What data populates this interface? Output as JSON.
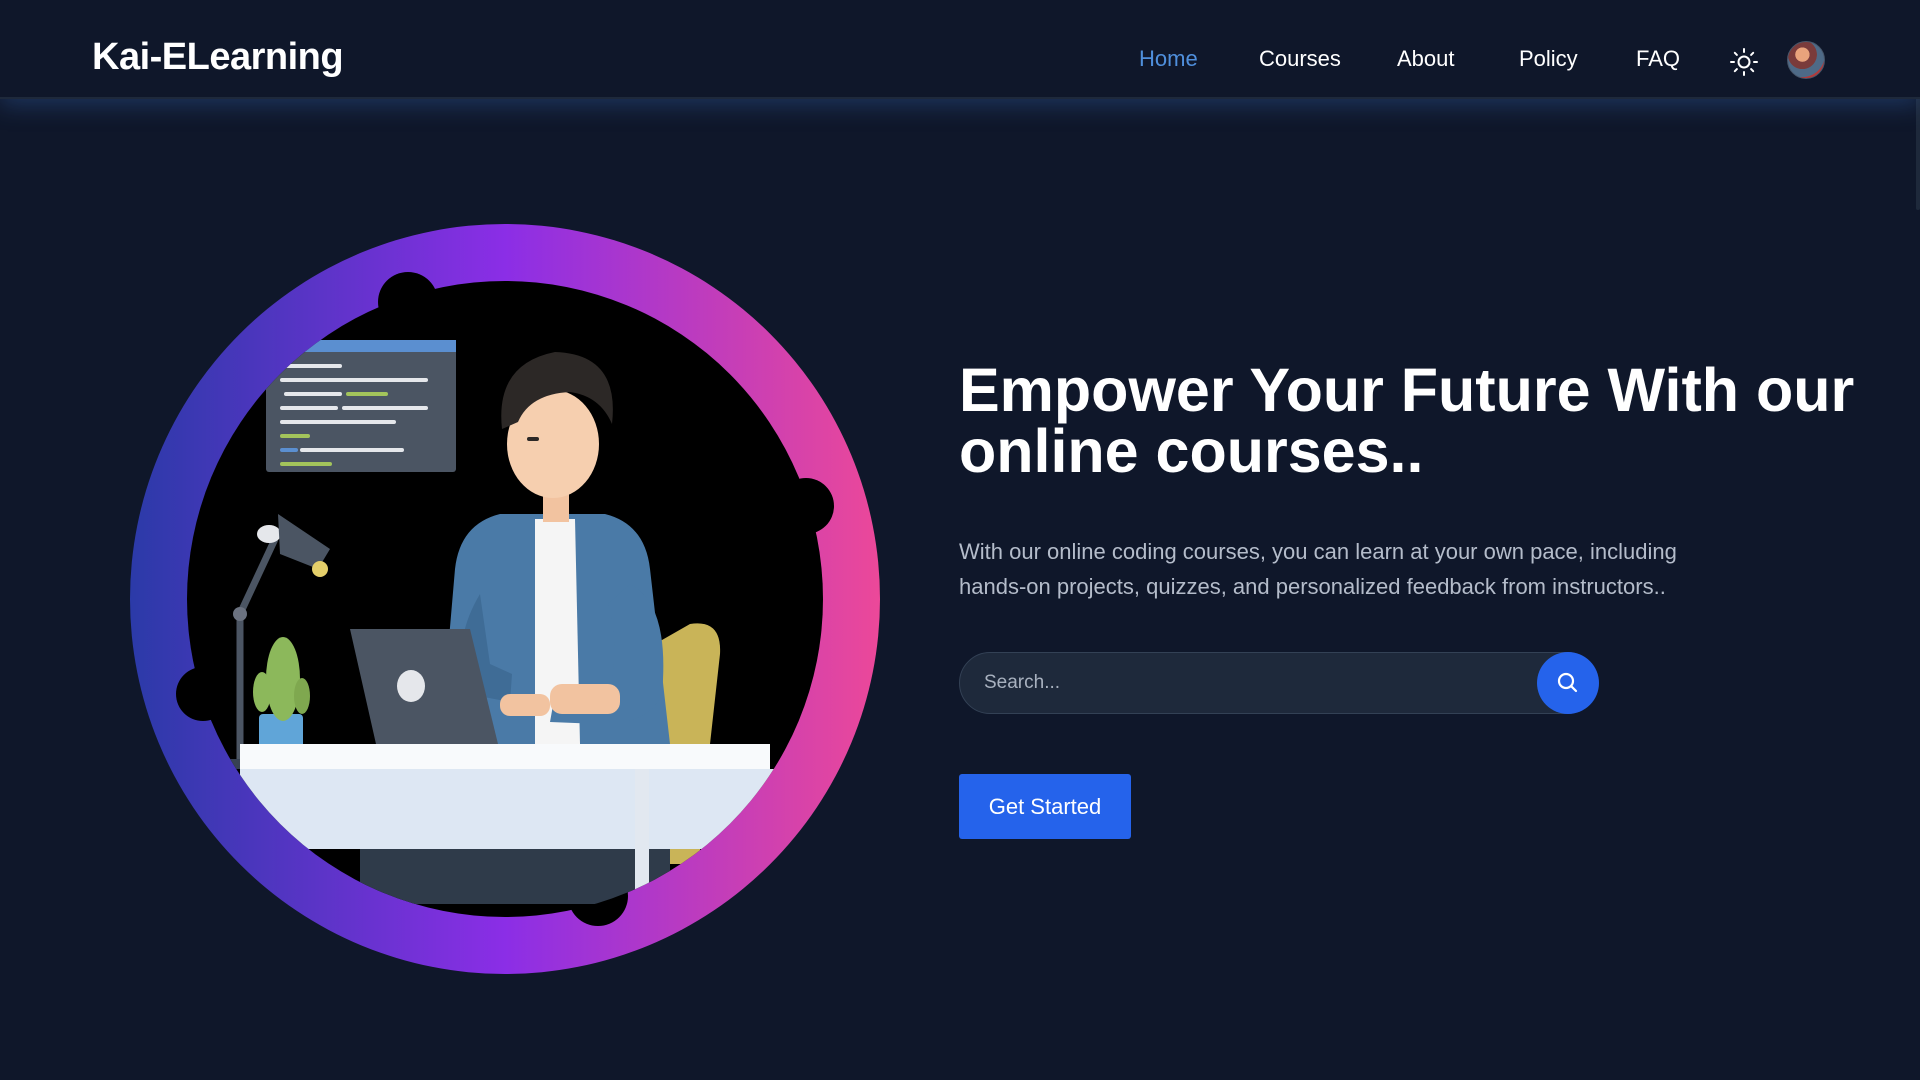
{
  "header": {
    "logo": "Kai-ELearning",
    "nav": [
      {
        "label": "Home",
        "active": true
      },
      {
        "label": "Courses",
        "active": false
      },
      {
        "label": "About",
        "active": false
      },
      {
        "label": "Policy",
        "active": false
      },
      {
        "label": "FAQ",
        "active": false
      }
    ],
    "theme_toggle_icon": "sun-icon",
    "avatar_icon": "user-avatar"
  },
  "hero": {
    "title": "Empower Your Future With our online courses..",
    "description": "With our online coding courses, you can learn at your own pace, including hands-on projects, quizzes, and personalized feedback from instructors..",
    "search": {
      "value": "",
      "placeholder": "Search...",
      "icon": "search-icon"
    },
    "cta_label": "Get Started",
    "illustration": "developer-at-laptop-illustration"
  },
  "colors": {
    "background": "#0f172a",
    "accent": "#2563eb",
    "nav_active": "#4f8fdc",
    "ring_start": "#2b3aa8",
    "ring_mid": "#8b2ee6",
    "ring_end": "#ec4899"
  }
}
